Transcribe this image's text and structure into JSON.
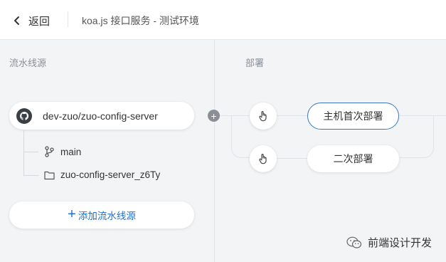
{
  "header": {
    "back_label": "返回",
    "title": "koa.js 接口服务 - 测试环境"
  },
  "pipeline_sources": {
    "section_label": "流水线源",
    "repo": {
      "icon": "github-icon",
      "name": "dev-zuo/zuo-config-server",
      "branch": "main",
      "directory": "zuo-config-server_z6Ty"
    },
    "add_label": "添加流水线源"
  },
  "deploy": {
    "section_label": "部署",
    "jobs": [
      {
        "label": "主机首次部署",
        "active": true
      },
      {
        "label": "二次部署",
        "active": false
      }
    ]
  },
  "watermark": "前端设计开发",
  "colors": {
    "accent": "#1f6fd0",
    "active_border": "#3a78c3",
    "background": "#f3f4f6"
  }
}
